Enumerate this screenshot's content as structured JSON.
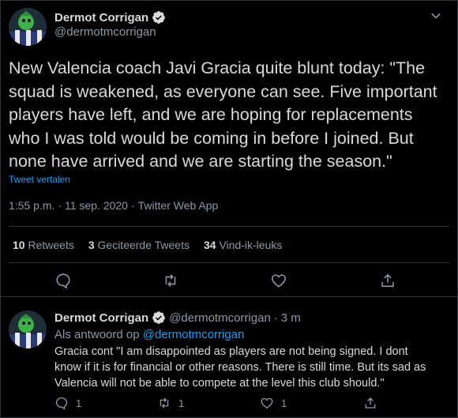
{
  "colors": {
    "background": "#000000",
    "text": "#d9d9d9",
    "muted": "#8b98a5",
    "accent": "#1d9bf0",
    "border": "#2f3336"
  },
  "main_tweet": {
    "author": {
      "display_name": "Dermot Corrigan",
      "handle": "@dermotmcorrigan",
      "verified_icon": "verified-badge-icon",
      "avatar_icon": "avatar"
    },
    "menu_icon": "chevron-down-icon",
    "text_lines": [
      "New Valencia coach Javi Gracia quite blunt today: \"The",
      "squad is weakened, as everyone can see. Five important",
      "players have left, and we are hoping for replacements",
      "who I was told would be coming in before I joined. But",
      "none have arrived and we are starting the season.\""
    ],
    "translate_label": "Tweet vertalen",
    "time": "1:55 p.m.",
    "separator": "·",
    "date": "11 sep. 2020",
    "source": "Twitter Web App",
    "stats": {
      "retweets_count": "10",
      "retweets_label": "Retweets",
      "quotes_count": "3",
      "quotes_label": "Geciteerde Tweets",
      "likes_count": "34",
      "likes_label": "Vind-ik-leuks"
    },
    "actions": [
      "reply-icon",
      "retweet-icon",
      "like-icon",
      "share-icon"
    ]
  },
  "reply_tweet": {
    "author": {
      "display_name": "Dermot Corrigan",
      "handle": "@dermotmcorrigan",
      "separator": "·",
      "time_ago": "3 m"
    },
    "replying_prefix": "Als antwoord op",
    "replying_mention": "@dermotmcorrigan",
    "text_lines": [
      "Gracia cont \"I am disappointed as players are not being signed. I dont",
      "know if it is for financial or other reasons. There is still time. But its sad as",
      "Valencia will not be able to compete at the level this club should.\""
    ],
    "actions": {
      "reply_count": "1",
      "retweet_count": "1",
      "like_count": "1"
    }
  }
}
